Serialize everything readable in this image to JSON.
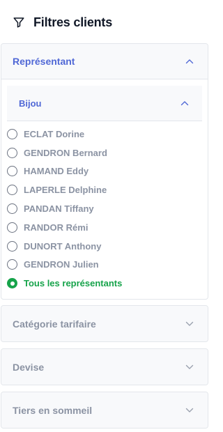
{
  "header": {
    "title": "Filtres clients",
    "icon": "filter-icon"
  },
  "representant": {
    "label": "Représentant",
    "group": {
      "label": "Bijou",
      "items": [
        {
          "name": "ECLAT Dorine",
          "selected": false
        },
        {
          "name": "GENDRON Bernard",
          "selected": false
        },
        {
          "name": "HAMAND Eddy",
          "selected": false
        },
        {
          "name": "LAPERLE Delphine",
          "selected": false
        },
        {
          "name": "PANDAN Tiffany",
          "selected": false
        },
        {
          "name": "RANDOR Rémi",
          "selected": false
        },
        {
          "name": "DUNORT Anthony",
          "selected": false
        },
        {
          "name": "GENDRON Julien",
          "selected": false
        },
        {
          "name": "Tous les représentants",
          "selected": true
        }
      ]
    }
  },
  "sections": [
    {
      "label": "Catégorie tarifaire"
    },
    {
      "label": "Devise"
    },
    {
      "label": "Tiers en sommeil"
    }
  ],
  "colors": {
    "accent": "#5068d6",
    "selected": "#16a34a",
    "muted_text": "#8b93a3",
    "border": "#e3e6eb",
    "header_bg": "#f8f9fb"
  }
}
